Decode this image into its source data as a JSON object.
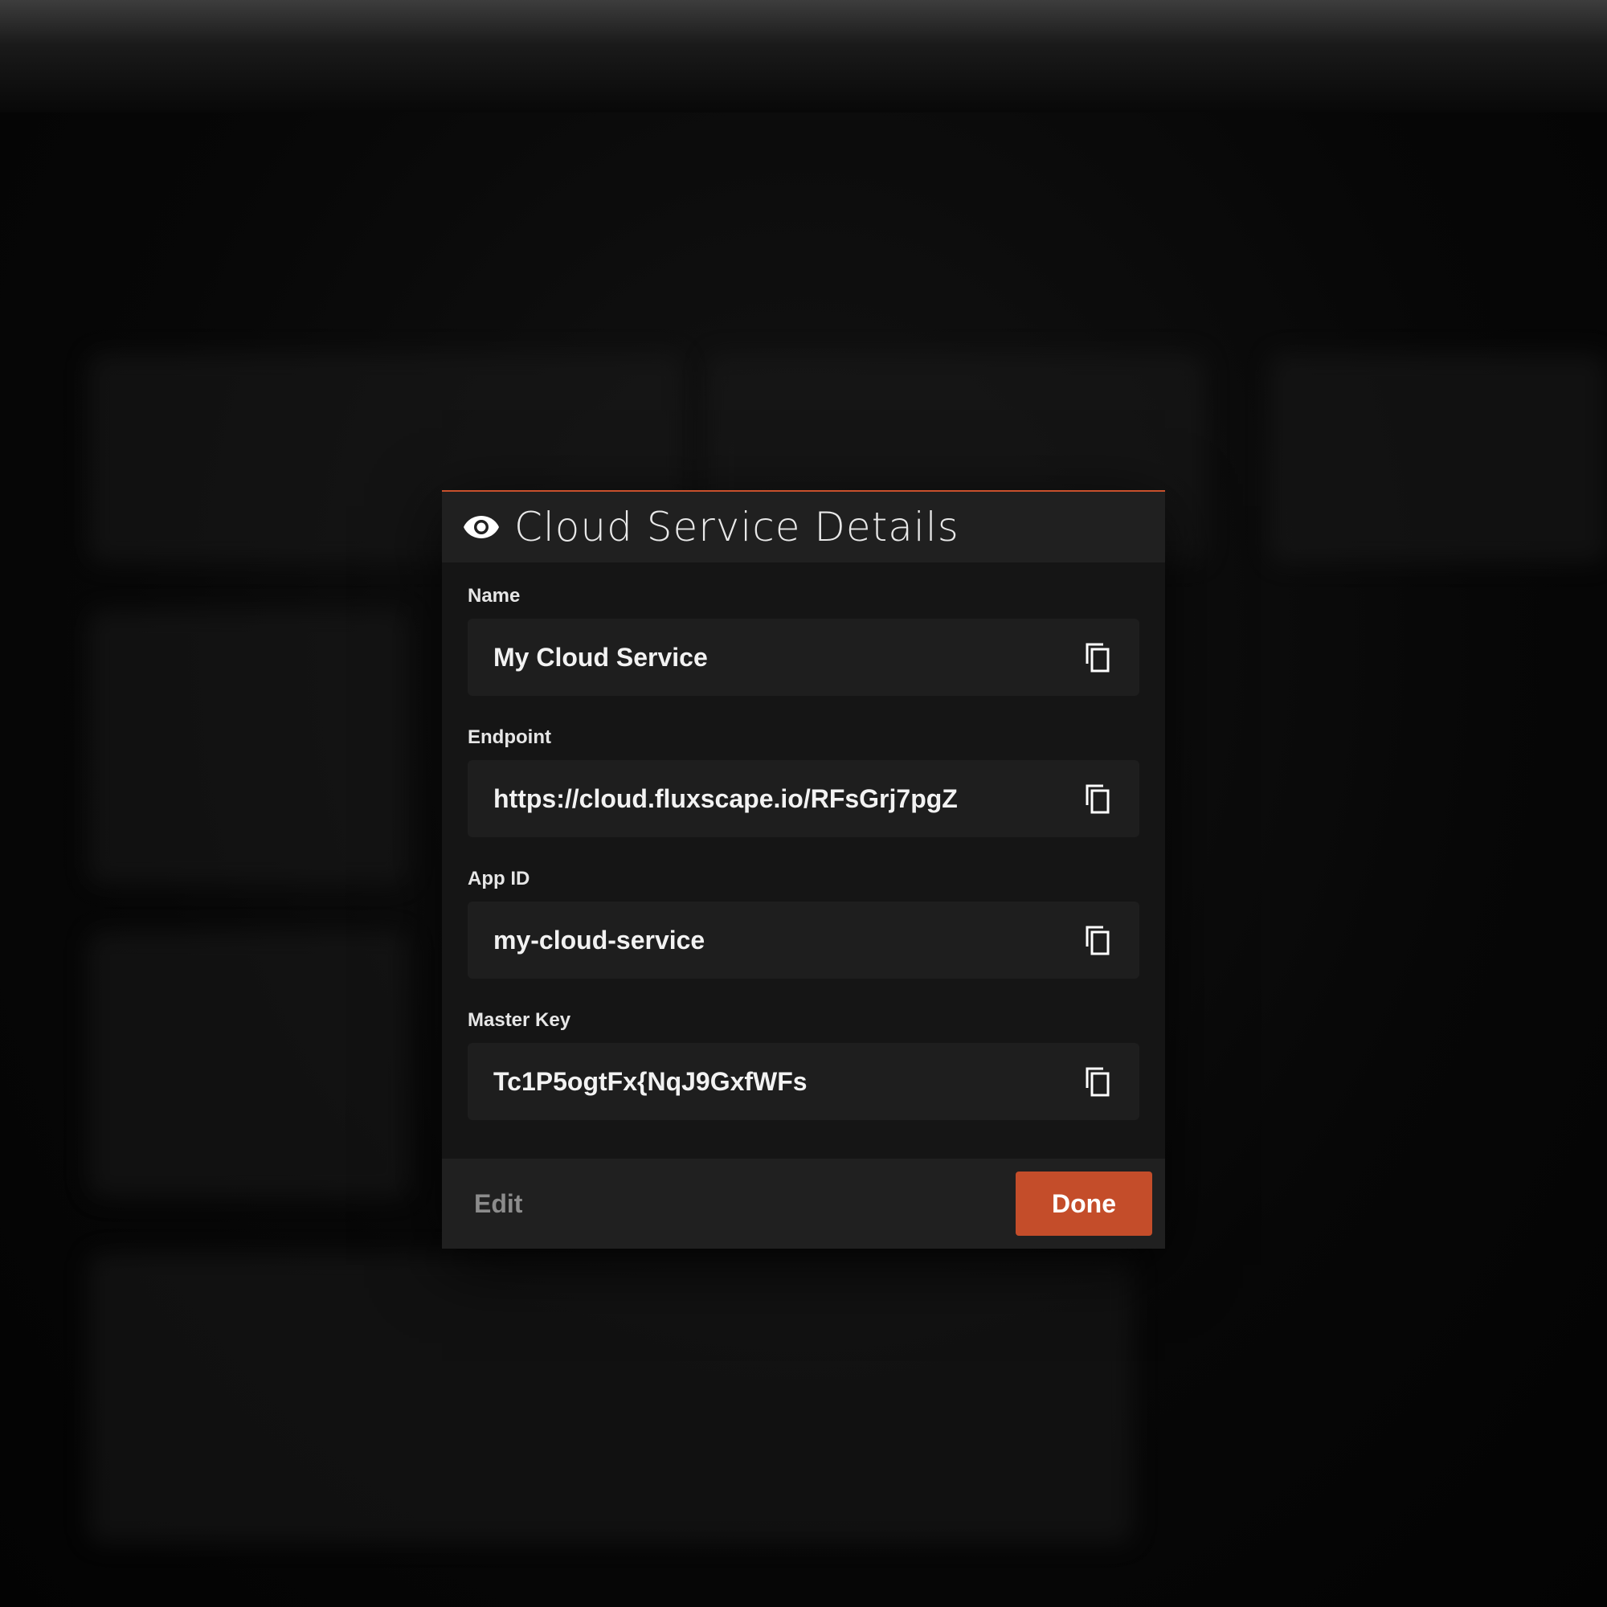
{
  "modal": {
    "title": "Cloud Service Details",
    "title_icon": "eye-icon",
    "accent_color": "#c8502c",
    "fields": [
      {
        "label": "Name",
        "value": "My Cloud Service",
        "icon": "copy-icon"
      },
      {
        "label": "Endpoint",
        "value": "https://cloud.fluxscape.io/RFsGrj7pgZ",
        "icon": "copy-icon"
      },
      {
        "label": "App ID",
        "value": "my-cloud-service",
        "icon": "copy-icon"
      },
      {
        "label": "Master Key",
        "value": "Tc1P5ogtFx{NqJ9GxfWFs",
        "icon": "copy-icon"
      }
    ],
    "footer": {
      "edit_label": "Edit",
      "done_label": "Done",
      "done_color": "#c44d2a"
    }
  }
}
